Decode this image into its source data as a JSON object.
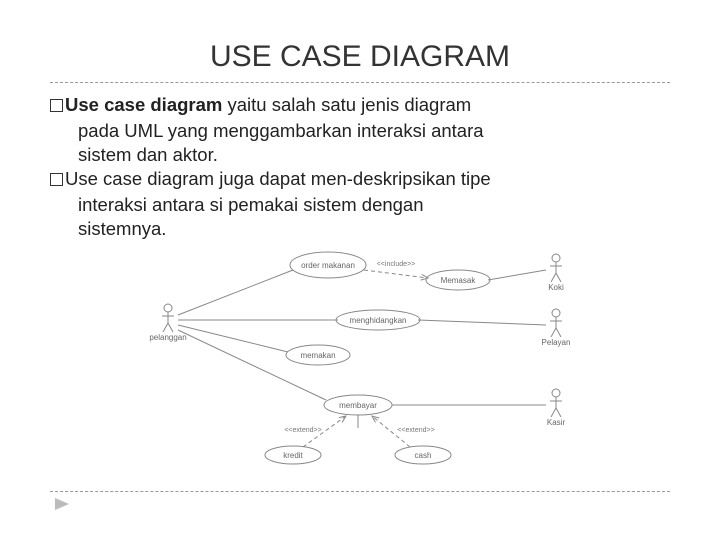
{
  "title": "USE CASE DIAGRAM",
  "bullets": [
    {
      "bold": "Use case diagram",
      "rest": " yaitu salah satu jenis diagram",
      "cont1": "pada UML yang menggambarkan interaksi antara",
      "cont2": "sistem dan aktor."
    },
    {
      "bold": "",
      "rest": "Use case diagram juga dapat men-deskripsikan tipe",
      "cont1": "interaksi antara si pemakai sistem dengan",
      "cont2": "sistemnya."
    }
  ],
  "diagram": {
    "actors": {
      "left": "pelanggan",
      "right_top": "Koki",
      "right_mid": "Pelayan",
      "right_bot": "Kasir"
    },
    "usecases": {
      "order": "order makanan",
      "cook": "Memasak",
      "serve": "menghidangkan",
      "eat": "memakan",
      "pay": "membayar",
      "credit": "kredit",
      "cash": "cash"
    },
    "stereotypes": {
      "include": "<<include>>",
      "extend": "<<extend>>"
    }
  }
}
